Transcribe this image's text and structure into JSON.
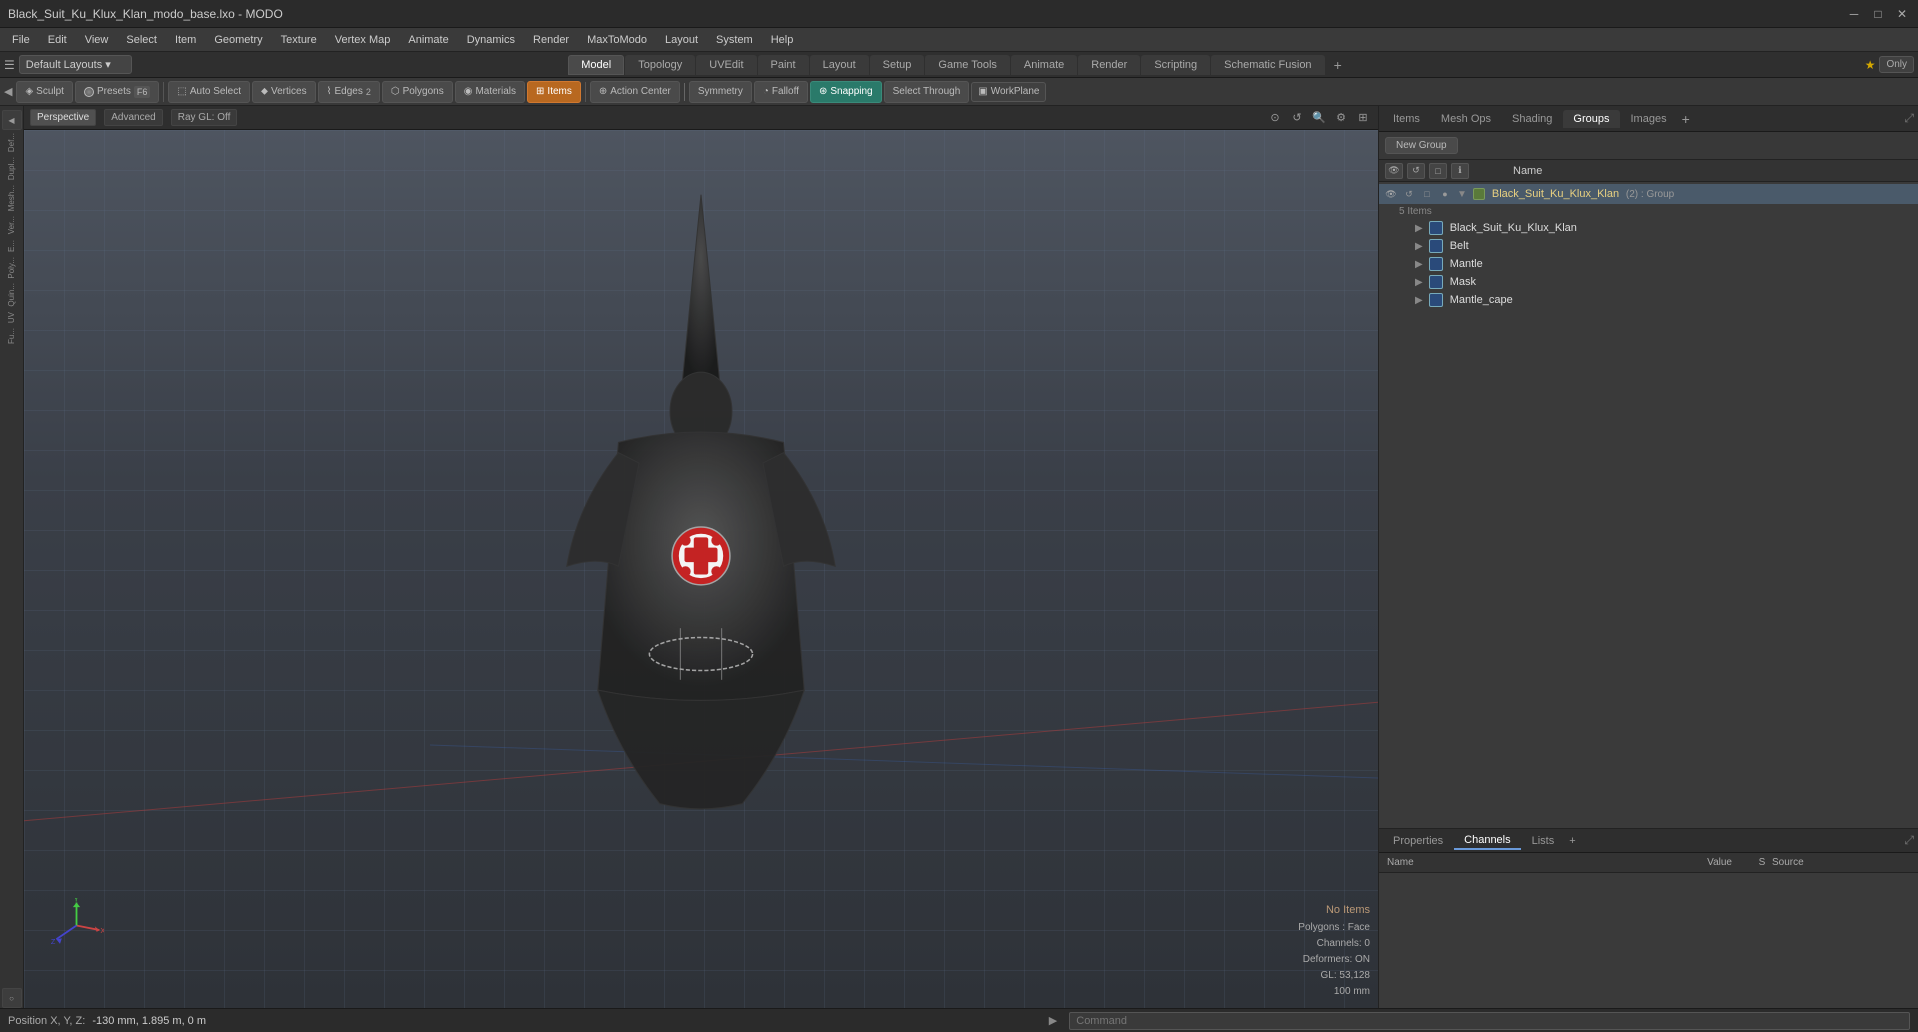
{
  "titlebar": {
    "title": "Black_Suit_Ku_Klux_Klan_modo_base.lxo - MODO",
    "min_btn": "─",
    "max_btn": "□",
    "close_btn": "✕"
  },
  "menubar": {
    "items": [
      "File",
      "Edit",
      "View",
      "Select",
      "Item",
      "Geometry",
      "Texture",
      "Vertex Map",
      "Animate",
      "Dynamics",
      "Render",
      "MaxToModo",
      "Layout",
      "System",
      "Help"
    ]
  },
  "layout_tabs": {
    "left_dropdown": "Default Layouts ▾",
    "left_icon": "★",
    "tabs": [
      "Model",
      "Topology",
      "UVEdit",
      "Paint",
      "Layout",
      "Setup",
      "Game Tools",
      "Animate",
      "Render",
      "Scripting",
      "Schematic Fusion"
    ],
    "active_tab": "Model",
    "add_btn": "+",
    "only_btn": "Only"
  },
  "mode_toolbar": {
    "sculpt_btn": "Sculpt",
    "presets_btn": "Presets",
    "presets_key": "F6",
    "auto_select_btn": "Auto Select",
    "vertices_btn": "Vertices",
    "vertices_count": "",
    "edges_btn": "Edges",
    "edges_count": "2",
    "polygons_btn": "Polygons",
    "materials_btn": "Materials",
    "items_btn": "Items",
    "action_center_btn": "Action Center",
    "symmetry_btn": "Symmetry",
    "falloff_btn": "Falloff",
    "snapping_btn": "Snapping",
    "select_through_btn": "Select Through",
    "workplane_btn": "WorkPlane"
  },
  "viewport": {
    "header": {
      "perspective_label": "Perspective",
      "advanced_label": "Advanced",
      "raygl_label": "Ray GL: Off"
    }
  },
  "viewport_status": {
    "no_items": "No Items",
    "polygons": "Polygons : Face",
    "channels": "Channels: 0",
    "deformers": "Deformers: ON",
    "gl": "GL: 53,128",
    "size": "100 mm"
  },
  "position_bar": {
    "label": "Position X, Y, Z:",
    "value": "-130 mm, 1.895 m, 0 m"
  },
  "right_panel": {
    "tabs": [
      "Items",
      "Mesh Ops",
      "Shading",
      "Groups",
      "Images"
    ],
    "active_tab": "Groups",
    "add_btn": "+"
  },
  "groups_toolbar": {
    "new_group_btn": "New Group",
    "col_icons": [
      "👁",
      "↺",
      "□",
      "ℹ"
    ]
  },
  "groups_col_header": {
    "name_label": "Name",
    "icons": [
      "eye",
      "reset",
      "square",
      "info"
    ]
  },
  "groups_tree": {
    "root": {
      "name": "Black_Suit_Ku_Klux_Klan",
      "count": "(2)",
      "type": "Group",
      "sub_count": "5 Items",
      "children": [
        {
          "name": "Black_Suit_Ku_Klux_Klan",
          "type": "mesh",
          "icon": "mesh"
        },
        {
          "name": "Belt",
          "type": "mesh",
          "icon": "mesh"
        },
        {
          "name": "Mantle",
          "type": "mesh",
          "icon": "mesh"
        },
        {
          "name": "Mask",
          "type": "mesh",
          "icon": "mesh"
        },
        {
          "name": "Mantle_cape",
          "type": "mesh",
          "icon": "mesh"
        }
      ]
    }
  },
  "bottom_panel": {
    "tabs": [
      "Properties",
      "Channels",
      "Lists"
    ],
    "active_tab": "Channels",
    "add_btn": "+",
    "col_headers": {
      "name": "Name",
      "value": "Value",
      "s": "S",
      "source": "Source"
    }
  },
  "command_bar": {
    "arrow": "▶",
    "placeholder": "Command"
  },
  "gizmo": {
    "x_color": "#cc4444",
    "y_color": "#44cc44",
    "z_color": "#4444cc"
  }
}
